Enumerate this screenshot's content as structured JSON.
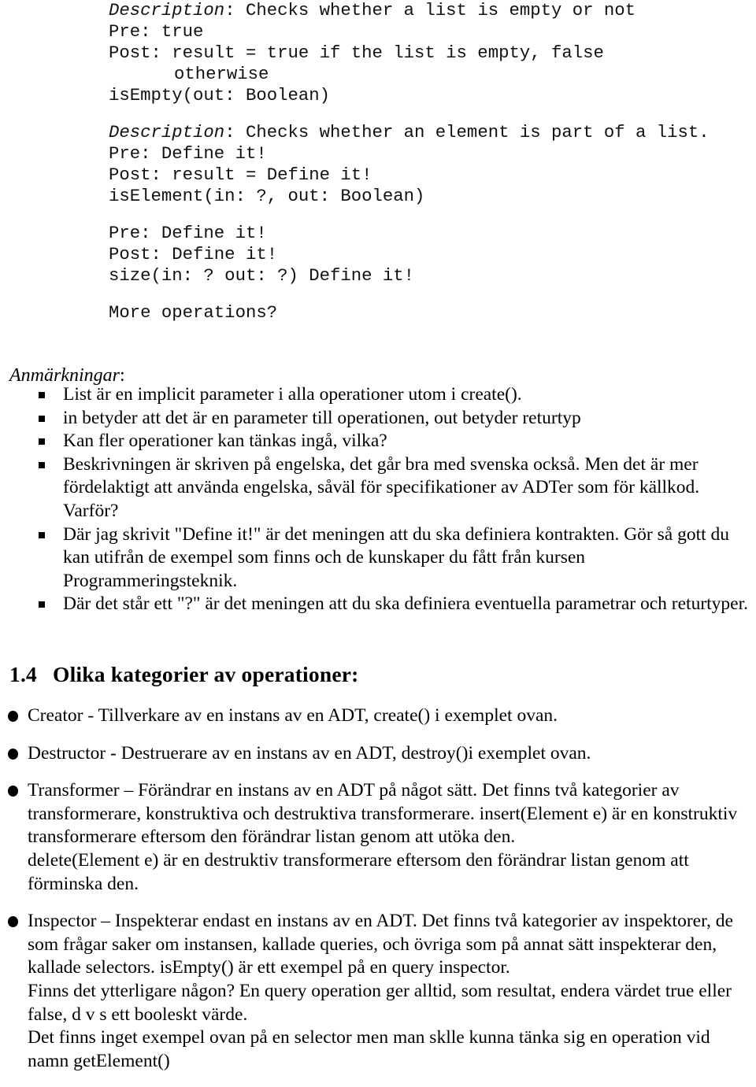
{
  "spec": {
    "blocks": [
      {
        "lines": [
          {
            "label": "Description",
            "label_style": "italic",
            "rest": ": Checks whether a list is empty or not",
            "indent": false
          },
          {
            "label": "",
            "label_style": "normal",
            "rest": "Pre: true",
            "indent": false
          },
          {
            "label": "",
            "label_style": "normal",
            "rest": "Post: result = true if the list is empty, false",
            "indent": false
          },
          {
            "label": "",
            "label_style": "normal",
            "rest": "otherwise",
            "indent": true
          },
          {
            "label": "",
            "label_style": "normal",
            "rest": "isEmpty(out: Boolean)",
            "indent": false
          }
        ]
      },
      {
        "lines": [
          {
            "label": "Description",
            "label_style": "italic",
            "rest": ": Checks whether an element is part of a list.",
            "indent": false
          },
          {
            "label": "",
            "label_style": "normal",
            "rest": "Pre: Define it!",
            "indent": false
          },
          {
            "label": "",
            "label_style": "normal",
            "rest": "Post: result = Define it!",
            "indent": false
          },
          {
            "label": "",
            "label_style": "normal",
            "rest": "isElement(in: ?, out: Boolean)",
            "indent": false
          }
        ]
      },
      {
        "lines": [
          {
            "label": "",
            "label_style": "normal",
            "rest": "Pre: Define it!",
            "indent": false
          },
          {
            "label": "",
            "label_style": "normal",
            "rest": "Post: Define it!",
            "indent": false
          },
          {
            "label": "",
            "label_style": "normal",
            "rest": "size(in: ? out: ?) Define it!",
            "indent": false
          }
        ]
      },
      {
        "lines": [
          {
            "label": "",
            "label_style": "normal",
            "rest": "More operations?",
            "indent": false
          }
        ]
      }
    ]
  },
  "notes": {
    "heading_italic": "Anmärkningar",
    "heading_colon": ":",
    "items": [
      "List är en implicit parameter i alla operationer utom i create().",
      "in betyder att det är en parameter till operationen, out betyder returtyp",
      "Kan fler operationer kan tänkas ingå, vilka?",
      "Beskrivningen är skriven på engelska, det går bra med svenska också. Men det är mer fördelaktigt att använda engelska, såväl för specifikationer av ADTer som för källkod. Varför?",
      "Där jag skrivit \"Define it!\" är det meningen att du ska definiera kontrakten. Gör så gott du kan utifrån de exempel som finns och de kunskaper du fått från kursen Programmeringsteknik.",
      "Där det står ett \"?\" är det meningen att du ska definiera eventuella parametrar och returtyper."
    ]
  },
  "section": {
    "number": "1.4",
    "title": "Olika kategorier av operationer:"
  },
  "categories": {
    "items": [
      {
        "paragraphs": [
          "Creator - Tillverkare av en instans av en ADT, create() i exemplet ovan."
        ]
      },
      {
        "paragraphs": [
          "Destructor - Destruerare av en instans av en ADT, destroy()i exemplet ovan."
        ]
      },
      {
        "paragraphs": [
          "Transformer – Förändrar en instans av en ADT på något sätt. Det finns två kategorier av transformerare, konstruktiva och destruktiva transformerare. insert(Element e) är en konstruktiv transformerare eftersom den förändrar listan genom att utöka den.",
          "delete(Element e) är en destruktiv transformerare eftersom den förändrar listan genom att förminska den."
        ]
      },
      {
        "paragraphs": [
          "Inspector – Inspekterar endast en instans av en ADT. Det finns två kategorier av inspektorer, de som frågar saker om instansen, kallade queries, och övriga som på annat sätt inspekterar den, kallade selectors. isEmpty() är ett exempel på en query inspector.",
          "Finns det ytterligare någon? En query operation ger alltid, som resultat, endera värdet true eller false, d v s ett booleskt värde.",
          "Det finns inget exempel ovan på en selector men man sklle kunna tänka sig en operation vid namn getElement()"
        ]
      }
    ]
  }
}
